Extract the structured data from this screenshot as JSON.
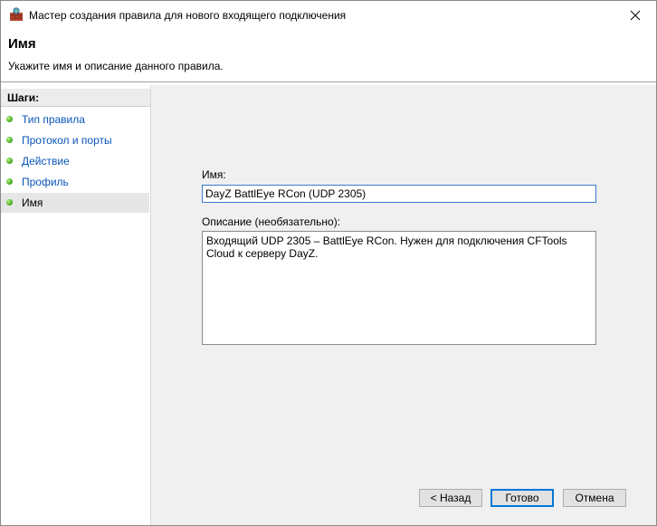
{
  "window": {
    "title": "Мастер создания правила для нового входящего подключения",
    "icon": "firewall-icon",
    "close_icon": "close-icon"
  },
  "header": {
    "title": "Имя",
    "subtitle": "Укажите имя и описание данного правила."
  },
  "steps": {
    "heading": "Шаги:",
    "items": [
      {
        "label": "Тип правила",
        "done": true,
        "current": false
      },
      {
        "label": "Протокол и порты",
        "done": true,
        "current": false
      },
      {
        "label": "Действие",
        "done": true,
        "current": false
      },
      {
        "label": "Профиль",
        "done": true,
        "current": false
      },
      {
        "label": "Имя",
        "done": true,
        "current": true
      }
    ]
  },
  "form": {
    "name_label": "Имя:",
    "name_value": "DayZ BattlEye RCon (UDP 2305)",
    "description_label": "Описание (необязательно):",
    "description_value": "Входящий UDP 2305 – BattlEye RCon. Нужен для подключения CFTools Cloud к серверу DayZ."
  },
  "buttons": {
    "back": "< Назад",
    "finish": "Готово",
    "cancel": "Отмена"
  },
  "colors": {
    "step_link": "#0a55b8",
    "step_dot": "#4fb52a",
    "focus_border": "#0078d7"
  }
}
